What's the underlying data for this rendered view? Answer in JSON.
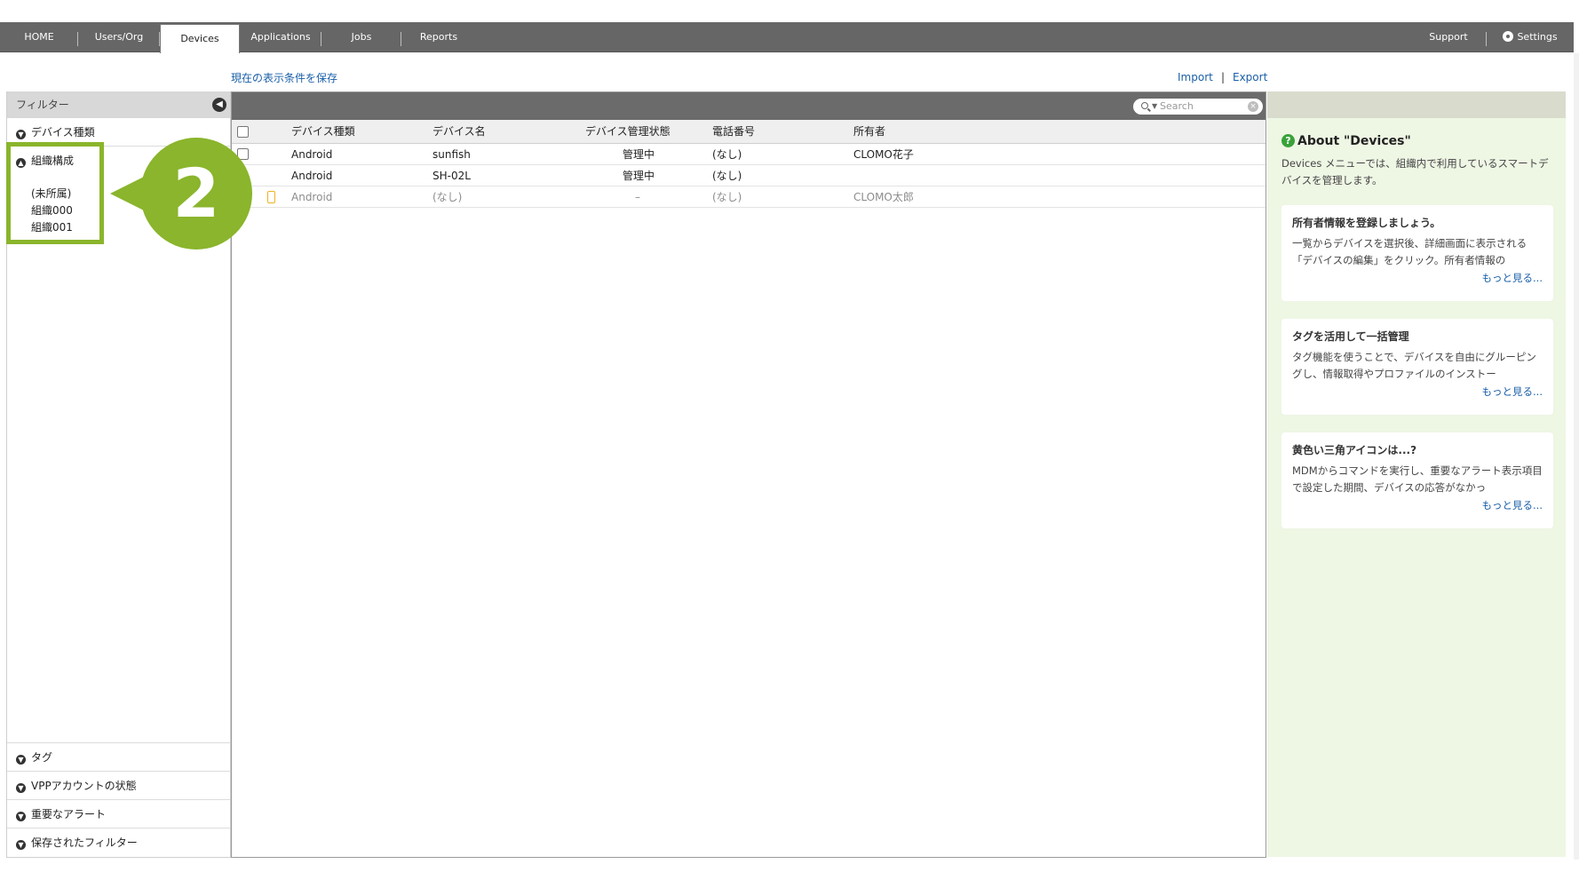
{
  "nav": {
    "tabs": [
      "HOME",
      "Users/Org",
      "Devices",
      "Applications",
      "Jobs",
      "Reports"
    ],
    "active_tab": "Devices",
    "support": "Support",
    "settings": "Settings"
  },
  "actions": {
    "save_view": "現在の表示条件を保存",
    "import": "Import",
    "separator": "|",
    "export": "Export"
  },
  "sidebar": {
    "title": "フィルター",
    "sections": {
      "device_type": "デバイス種類",
      "org": "組織構成",
      "tag": "タグ",
      "vpp": "VPPアカウントの状態",
      "alert": "重要なアラート",
      "saved": "保存されたフィルター"
    },
    "org_items": [
      "(未所属)",
      "組織000",
      "組織001"
    ]
  },
  "callout": {
    "number": "2"
  },
  "search": {
    "placeholder": "Search"
  },
  "table": {
    "columns": [
      "デバイス種類",
      "デバイス名",
      "デバイス管理状態",
      "電話番号",
      "所有者"
    ],
    "rows": [
      {
        "type": "Android",
        "name": "sunfish",
        "status": "管理中",
        "phone": "(なし)",
        "owner": "CLOMO花子"
      },
      {
        "type": "Android",
        "name": "SH-02L",
        "status": "管理中",
        "phone": "(なし)",
        "owner": ""
      },
      {
        "type": "Android",
        "name": "(なし)",
        "status": "–",
        "phone": "(なし)",
        "owner": "CLOMO太郎"
      }
    ]
  },
  "info": {
    "title": "About \"Devices\"",
    "description": "Devices メニューでは、組織内で利用しているスマートデバイスを管理します。",
    "cards": [
      {
        "title": "所有者情報を登録しましょう。",
        "body": "一覧からデバイスを選択後、詳細画面に表示される「デバイスの編集」をクリック。所有者情報の",
        "more": "もっと見る..."
      },
      {
        "title": "タグを活用して一括管理",
        "body": "タグ機能を使うことで、デバイスを自由にグルーピングし、情報取得やプロファイルのインストー",
        "more": "もっと見る..."
      },
      {
        "title": "黄色い三角アイコンは...?",
        "body": "MDMからコマンドを実行し、重要なアラート表示項目で設定した期間、デバイスの応答がなかっ",
        "more": "もっと見る..."
      }
    ]
  },
  "colors": {
    "nav_bg": "#666666",
    "highlight": "#8ab52c",
    "link": "#1a5fa8",
    "info_bg": "#eef6e4",
    "device_icon": "#f0b323"
  }
}
